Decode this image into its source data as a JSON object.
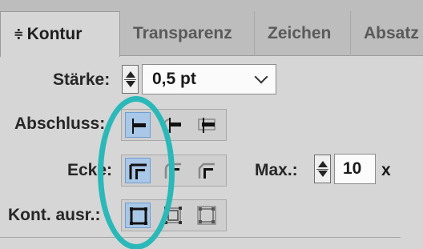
{
  "tabs": [
    {
      "label": "Kontur",
      "arrows": "≑"
    },
    {
      "label": "Transparenz"
    },
    {
      "label": "Zeichen"
    },
    {
      "label": "Absatz"
    }
  ],
  "staerke": {
    "label": "Stärke:",
    "value": "0,5 pt"
  },
  "abschluss": {
    "label": "Abschluss:"
  },
  "ecke": {
    "label": "Ecke:",
    "max_label": "Max.:",
    "max_value": "10",
    "unit": "x"
  },
  "kontur_ausrichten": {
    "label": "Kont. ausr.:"
  },
  "colors": {
    "highlight": "#2ab8b8",
    "selected": "#a9c7e6"
  },
  "icons": {
    "abschluss": [
      "butt-cap-icon",
      "round-cap-icon",
      "projecting-cap-icon"
    ],
    "ecke": [
      "miter-join-icon",
      "round-join-icon",
      "bevel-join-icon"
    ],
    "ausrichten": [
      "align-center-icon",
      "align-inside-icon",
      "align-outside-icon"
    ]
  }
}
